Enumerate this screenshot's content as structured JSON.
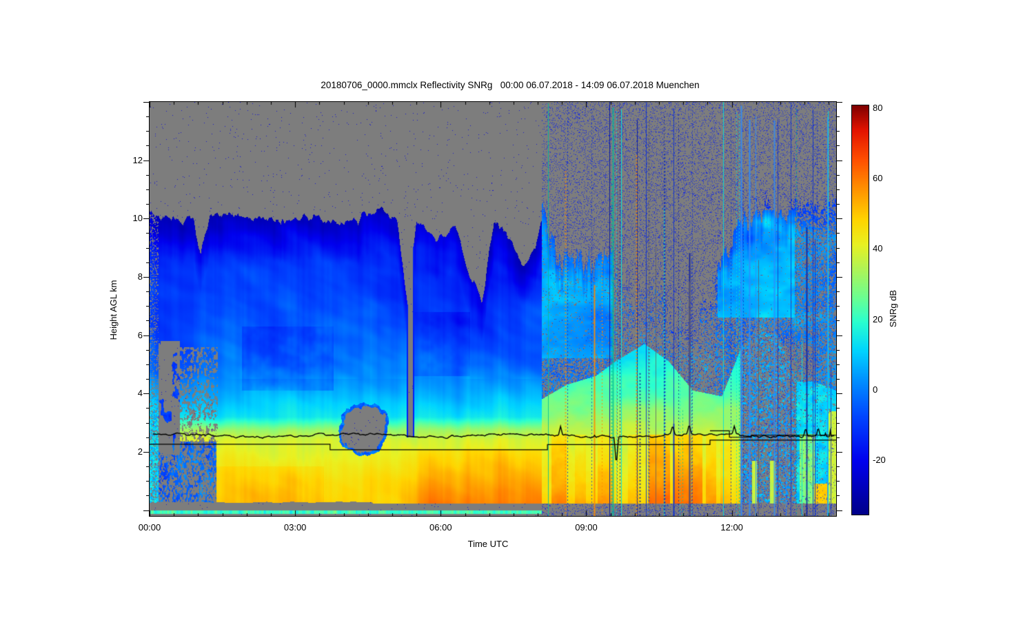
{
  "chart_data": {
    "type": "heatmap",
    "title": "20180706_0000.mmclx Reflectivity SNRg   00:00 06.07.2018 - 14:09 06.07.2018 Muenchen",
    "xlabel": "Time UTC",
    "ylabel": "Height AGL km",
    "x_axis": {
      "tick_labels": [
        "00:00",
        "03:00",
        "06:00",
        "09:00",
        "12:00"
      ],
      "tick_hours": [
        0,
        3,
        6,
        9,
        12
      ],
      "minor_step_hours": 0.5,
      "range_hours": [
        0,
        14.15
      ]
    },
    "y_axis": {
      "tick_labels": [
        "2",
        "4",
        "6",
        "8",
        "10",
        "12"
      ],
      "tick_km": [
        2,
        4,
        6,
        8,
        10,
        12
      ],
      "minor_step_km": 0.5,
      "range_km": [
        -0.2,
        14.0
      ]
    },
    "colorbar": {
      "label": "SNRg dB",
      "tick_labels": [
        "80",
        "60",
        "40",
        "20",
        "0",
        "-20"
      ],
      "tick_values": [
        80,
        60,
        40,
        20,
        0,
        -20
      ],
      "range": [
        -35.6,
        80.9
      ]
    },
    "colors": {
      "nodata_gray": "#7d7d7d",
      "background": "#ffffff",
      "axis": "#000000",
      "speckle_blue_left": "#1818cc",
      "speckle_blue_right": "#2334d4",
      "line_black": "#000000",
      "jet_stops": [
        [
          0.0,
          "#000089"
        ],
        [
          0.13,
          "#0000ee"
        ],
        [
          0.24,
          "#0046ff"
        ],
        [
          0.33,
          "#0092ff"
        ],
        [
          0.4,
          "#00d4ff"
        ],
        [
          0.47,
          "#2affd0"
        ],
        [
          0.53,
          "#6bff92"
        ],
        [
          0.6,
          "#b0f457"
        ],
        [
          0.66,
          "#e9f122"
        ],
        [
          0.72,
          "#ffd500"
        ],
        [
          0.79,
          "#ff9700"
        ],
        [
          0.87,
          "#ff4d00"
        ],
        [
          0.94,
          "#e21300"
        ],
        [
          1.0,
          "#7f0000"
        ]
      ]
    },
    "features": {
      "regime_change_hour": 8.08,
      "speckle_density_left": 0.006,
      "speckle_density_right": 0.13,
      "melting_layer_km": 2.58,
      "cloud_top_km": [
        [
          0,
          10.15
        ],
        [
          0.9,
          9.95
        ],
        [
          1.05,
          8.6
        ],
        [
          1.25,
          10.2
        ],
        [
          2.2,
          10.0
        ],
        [
          3.2,
          10.05
        ],
        [
          4.1,
          9.85
        ],
        [
          4.75,
          10.3
        ],
        [
          5.1,
          10.0
        ],
        [
          5.32,
          7.2
        ],
        [
          5.5,
          9.9
        ],
        [
          5.95,
          9.2
        ],
        [
          6.3,
          9.7
        ],
        [
          6.55,
          8.3
        ],
        [
          6.85,
          7.1
        ],
        [
          7.1,
          9.8
        ],
        [
          7.45,
          9.3
        ],
        [
          7.7,
          8.3
        ],
        [
          7.95,
          9.0
        ],
        [
          8.1,
          10.1
        ],
        [
          8.45,
          8.5
        ],
        [
          8.8,
          8.8
        ],
        [
          9.1,
          8.1
        ],
        [
          9.45,
          8.8
        ],
        [
          9.8,
          7.8
        ],
        [
          10.1,
          7.3
        ],
        [
          10.45,
          7.7
        ],
        [
          10.75,
          6.4
        ],
        [
          11.1,
          6.1
        ],
        [
          11.45,
          6.9
        ],
        [
          11.8,
          8.8
        ],
        [
          12.1,
          9.6
        ],
        [
          12.45,
          10.2
        ],
        [
          12.8,
          10.5
        ],
        [
          13.1,
          10.1
        ],
        [
          13.45,
          10.7
        ],
        [
          13.8,
          10.2
        ],
        [
          14.15,
          10.5
        ]
      ],
      "cloud_base_right_km": [
        [
          8.08,
          3.8
        ],
        [
          8.6,
          4.3
        ],
        [
          9.2,
          4.6
        ],
        [
          9.6,
          5.1
        ],
        [
          10.2,
          5.7
        ],
        [
          10.7,
          5.1
        ],
        [
          11.2,
          4.1
        ],
        [
          11.8,
          3.9
        ],
        [
          12.2,
          5.6
        ],
        [
          12.6,
          6.4
        ],
        [
          13.0,
          5.9
        ],
        [
          13.35,
          4.4
        ],
        [
          13.7,
          4.4
        ],
        [
          14.15,
          4.1
        ]
      ],
      "profile_left_km_db": [
        [
          0,
          49
        ],
        [
          1.0,
          46
        ],
        [
          2.4,
          39
        ],
        [
          2.75,
          32
        ],
        [
          3.2,
          14
        ],
        [
          5,
          -4
        ],
        [
          10.5,
          -18
        ],
        [
          14,
          -22
        ]
      ],
      "red_columns": [
        [
          8.32,
          8.55,
          10
        ],
        [
          8.8,
          8.95,
          5
        ],
        [
          9.28,
          9.5,
          8
        ],
        [
          9.9,
          10.05,
          5
        ],
        [
          10.32,
          10.68,
          15
        ],
        [
          10.85,
          11.35,
          13
        ],
        [
          11.5,
          11.64,
          8
        ],
        [
          11.8,
          11.95,
          5
        ]
      ],
      "yellow_columns": [
        [
          12.42,
          12.52
        ],
        [
          12.78,
          12.9
        ]
      ],
      "weak_zone_hours": [
        12.18,
        13.33
      ],
      "gray_hole": {
        "t": [
          3.82,
          5.0
        ],
        "h": [
          1.8,
          3.8
        ]
      },
      "gap_column_hours": [
        5.3,
        5.46
      ],
      "surface_rain_hours": [
        5.3,
        8.08
      ],
      "line_spikes": [
        [
          8.47,
          0.33
        ],
        [
          9.62,
          -1.0
        ],
        [
          10.78,
          0.3
        ],
        [
          11.12,
          0.33
        ],
        [
          12.05,
          0.28
        ],
        [
          13.52,
          0.28
        ],
        [
          13.78,
          0.3
        ]
      ],
      "model_line_km": [
        [
          0,
          2.26
        ],
        [
          3.72,
          2.26
        ],
        [
          3.72,
          2.07
        ],
        [
          8.2,
          2.07
        ],
        [
          8.2,
          2.25
        ],
        [
          11.55,
          2.25
        ],
        [
          11.55,
          2.4
        ],
        [
          14.15,
          2.4
        ]
      ],
      "model_line_upper_km": [
        [
          11.55,
          2.72
        ],
        [
          11.95,
          2.72
        ],
        [
          11.95,
          2.5
        ],
        [
          12.4,
          2.5
        ],
        [
          12.4,
          2.57
        ],
        [
          14.15,
          2.57
        ]
      ],
      "stripes": {
        "count": 58,
        "seed": 1234,
        "palette": [
          "#00e0e0",
          "#2c8cff",
          "#1133cc",
          "#0a1a9e",
          "#5a5a6a",
          "#00bf9a",
          "#ff8c00"
        ],
        "weights": [
          0.26,
          0.16,
          0.22,
          0.12,
          0.12,
          0.07,
          0.05
        ]
      }
    }
  }
}
